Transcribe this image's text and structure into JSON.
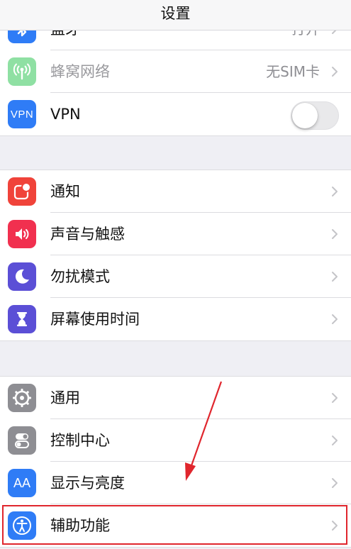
{
  "nav": {
    "title": "设置"
  },
  "group1": {
    "bluetooth": {
      "label": "蓝牙",
      "value": "打开",
      "icon": "bluetooth-icon"
    },
    "cellular": {
      "label": "蜂窝网络",
      "value": "无SIM卡",
      "icon": "cellular-antenna-icon"
    },
    "vpn": {
      "label": "VPN",
      "icon_text": "VPN",
      "toggle_on": false
    }
  },
  "group2": {
    "items": [
      {
        "label": "通知",
        "icon": "notification-icon",
        "color": "#f0433a"
      },
      {
        "label": "声音与触感",
        "icon": "speaker-icon",
        "color": "#f1304f"
      },
      {
        "label": "勿扰模式",
        "icon": "moon-icon",
        "color": "#5b4fd6"
      },
      {
        "label": "屏幕使用时间",
        "icon": "hourglass-icon",
        "color": "#5b4fd6"
      }
    ]
  },
  "group3": {
    "items": [
      {
        "label": "通用",
        "icon": "gear-icon",
        "color": "#8e8e93"
      },
      {
        "label": "控制中心",
        "icon": "toggles-icon",
        "color": "#8e8e93"
      },
      {
        "label": "显示与亮度",
        "icon": "text-size-icon",
        "icon_text": "AA",
        "color": "#2f7cf6"
      },
      {
        "label": "辅助功能",
        "icon": "accessibility-icon",
        "color": "#2f7cf6"
      }
    ]
  },
  "annotation": {
    "color": "#e0262d"
  }
}
